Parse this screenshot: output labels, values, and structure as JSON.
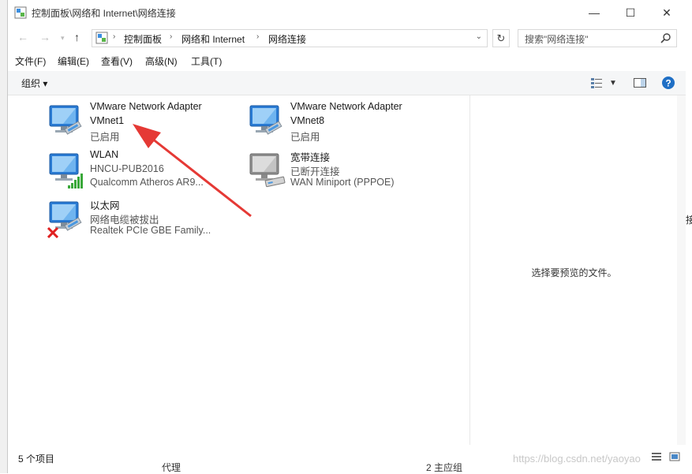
{
  "window": {
    "title": "控制面板\\网络和 Internet\\网络连接",
    "controls": {
      "minimize": "—",
      "maximize": "☐",
      "close": "✕"
    }
  },
  "address_bar": {
    "crumbs": [
      "控制面板",
      "网络和 Internet",
      "网络连接"
    ]
  },
  "search": {
    "placeholder": "搜索\"网络连接\""
  },
  "menu": [
    "文件(F)",
    "编辑(E)",
    "查看(V)",
    "高级(N)",
    "工具(T)"
  ],
  "toolbar": {
    "organize_label": "组织 ▾"
  },
  "connections": [
    {
      "name": "VMware Network Adapter",
      "line2": "VMnet1",
      "line3": "已启用",
      "icon": "network-adapter-icon"
    },
    {
      "name": "VMware Network Adapter",
      "line2": "VMnet8",
      "line3": "已启用",
      "icon": "network-adapter-icon"
    },
    {
      "name": "WLAN",
      "line2": "HNCU-PUB2016",
      "line3": "Qualcomm Atheros AR9...",
      "icon": "wifi-adapter-icon"
    },
    {
      "name": "宽带连接",
      "line2": "已断开连接",
      "line3": "WAN Miniport (PPPOE)",
      "icon": "broadband-icon"
    },
    {
      "name": "以太网",
      "line2": "网络电缆被拔出",
      "line3": "Realtek PCIe GBE Family...",
      "icon": "ethernet-unplugged-icon"
    }
  ],
  "preview_pane": {
    "message": "选择要预览的文件。"
  },
  "status": {
    "item_count": "5 个项目"
  },
  "background_fragments": {
    "right": "接",
    "bottom_left": "代理",
    "bottom_mid": "2  主应组",
    "watermark": "https://blog.csdn.net/yaoyao"
  },
  "colors": {
    "arrow": "#e53935",
    "icon_blue": "#1e88e5"
  }
}
